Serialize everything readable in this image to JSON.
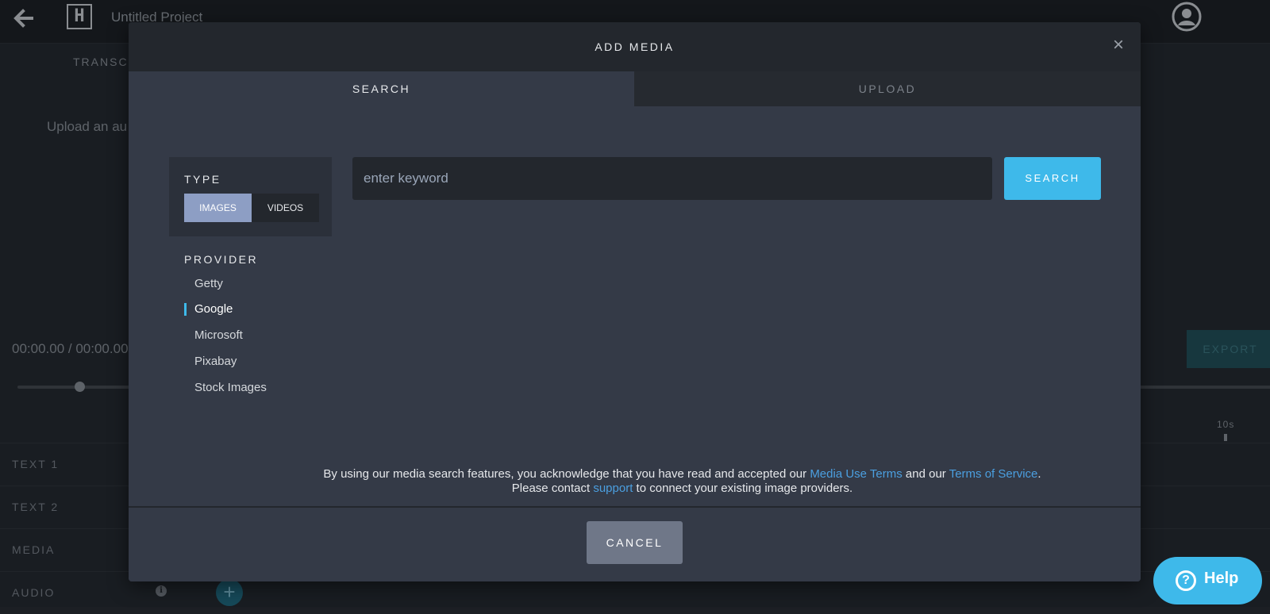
{
  "background": {
    "project_title": "Untitled Project",
    "logo_letter": "H",
    "transcript_tab": "TRANSC",
    "upload_hint": "Upload an au",
    "time_readout": "00:00.00 / 00:00.00",
    "export_label": "EXPORT",
    "ruler_label": "10s",
    "tracks": [
      {
        "label": "TEXT 1"
      },
      {
        "label": "TEXT 2"
      },
      {
        "label": "MEDIA"
      },
      {
        "label": "AUDIO"
      }
    ],
    "add_track_symbol": "+",
    "info_symbol": "i"
  },
  "modal": {
    "title": "ADD MEDIA",
    "close_symbol": "×",
    "tabs": {
      "search": "SEARCH",
      "upload": "UPLOAD",
      "active": "search"
    },
    "type": {
      "label": "TYPE",
      "options": [
        "IMAGES",
        "VIDEOS"
      ],
      "selected": "IMAGES"
    },
    "provider": {
      "label": "PROVIDER",
      "items": [
        "Getty",
        "Google",
        "Microsoft",
        "Pixabay",
        "Stock Images"
      ],
      "selected": "Google"
    },
    "search": {
      "placeholder": "enter keyword",
      "value": "",
      "button_label": "SEARCH"
    },
    "disclaimer": {
      "part1": "By using our media search features, you acknowledge that you have read and accepted our ",
      "link1": "Media Use Terms",
      "part2": " and our ",
      "link2": "Terms of Service",
      "part3": ".",
      "part4": "Please contact ",
      "link3": "support",
      "part5": " to connect your existing image providers."
    },
    "cancel_label": "CANCEL"
  },
  "help": {
    "icon_symbol": "?",
    "label": "Help"
  },
  "colors": {
    "accent": "#3eb9ea",
    "link": "#4b9fe0",
    "selected_toggle": "#8d9ec4"
  }
}
